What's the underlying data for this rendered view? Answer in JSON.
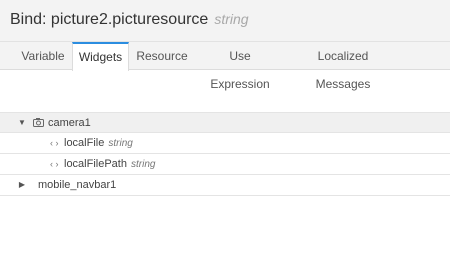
{
  "header": {
    "title": "Bind: picture2.picturesource",
    "type": "string"
  },
  "tabs": [
    {
      "label": "Variable"
    },
    {
      "label": "Widgets"
    },
    {
      "label": "Resource"
    },
    {
      "label": "Use Expression"
    },
    {
      "label": "Localized Messages"
    }
  ],
  "active_tab": "Widgets",
  "tree": {
    "camera": {
      "name": "camera1",
      "icon": "camera-icon",
      "expanded": true
    },
    "children": [
      {
        "name": "localFile",
        "type": "string",
        "icon": "code-brackets-icon"
      },
      {
        "name": "localFilePath",
        "type": "string",
        "icon": "code-brackets-icon"
      }
    ],
    "navbar": {
      "name": "mobile_navbar1",
      "expanded": false
    }
  },
  "glyphs": {
    "expanded": "▼",
    "collapsed": "▶",
    "code": "‹ ›"
  },
  "colors": {
    "accent": "#2b8de0",
    "header_bg": "#f3f3f3",
    "type_text": "#a8a8a8"
  }
}
